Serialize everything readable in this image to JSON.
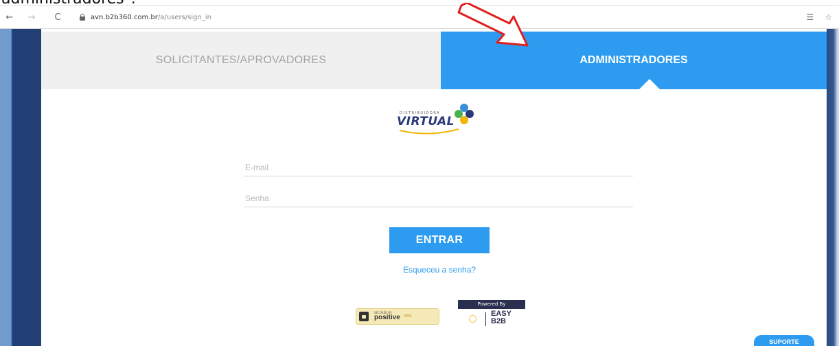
{
  "caption": "administradores\".",
  "browser": {
    "back_icon": "←",
    "forward_icon": "→",
    "reload_icon": "C",
    "url_host": "avn.b2b360.com.br",
    "url_path": "/a/users/sign_in",
    "right_icons": [
      "☰",
      "☆"
    ]
  },
  "tabs": {
    "left_label": "SOLICITANTES/APROVADORES",
    "right_label": "ADMINISTRADORES"
  },
  "logo": {
    "subtitle": "DISTRIBUIDORA",
    "word": "VIRTUAL"
  },
  "form": {
    "email_placeholder": "E-mail",
    "password_placeholder": "Senha",
    "submit_label": "ENTRAR",
    "forgot_label": "Esqueceu a senha?"
  },
  "badges": {
    "positive_small": "SECURED BY",
    "positive_big": "positive",
    "positive_ssl": "SSL",
    "easy_powered": "Powered By",
    "easy_name_1": "EASY",
    "easy_name_2": "B2B"
  },
  "suporte_label": "SUPORTE",
  "colors": {
    "accent": "#2d9cf0",
    "tab_inactive_bg": "#f0f0f0",
    "side_dark": "#233f73",
    "annotation_arrow": "#e02020"
  }
}
